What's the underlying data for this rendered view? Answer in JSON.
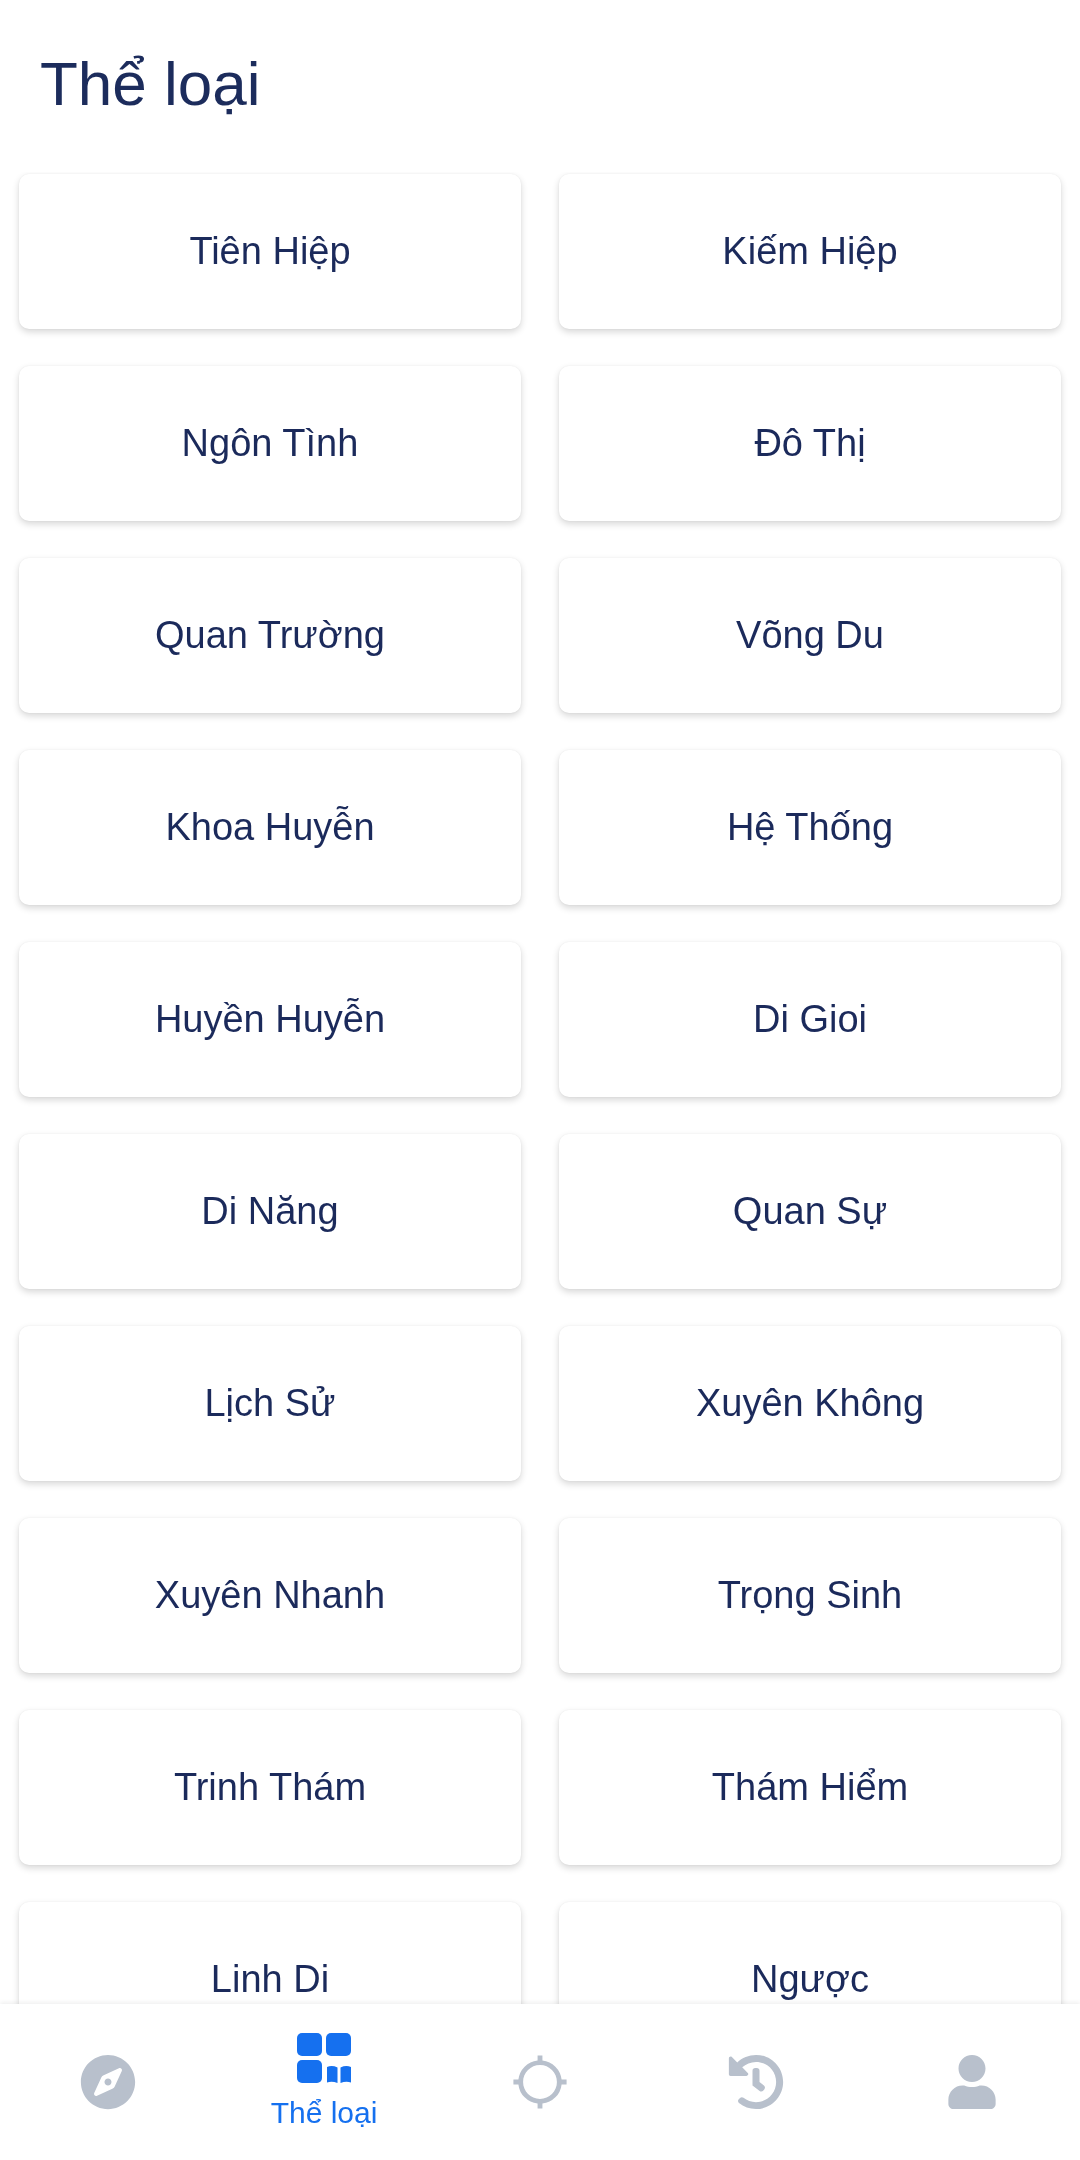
{
  "title": "Thể loại",
  "categories": [
    "Tiên Hiệp",
    "Kiếm Hiệp",
    "Ngôn Tình",
    "Đô Thị",
    "Quan Trường",
    "Võng Du",
    "Khoa Huyễn",
    "Hệ Thống",
    "Huyền Huyễn",
    "Di Gioi",
    "Di Năng",
    "Quan Sự",
    "Lịch Sử",
    "Xuyên Không",
    "Xuyên Nhanh",
    "Trọng Sinh",
    "Trinh Thám",
    "Thám Hiểm",
    "Linh Di",
    "Ngược"
  ],
  "bottom_nav": [
    {
      "selected": false
    },
    {
      "selected": true,
      "label": "Thể loại"
    },
    {
      "selected": false
    },
    {
      "selected": false
    },
    {
      "selected": false
    }
  ]
}
